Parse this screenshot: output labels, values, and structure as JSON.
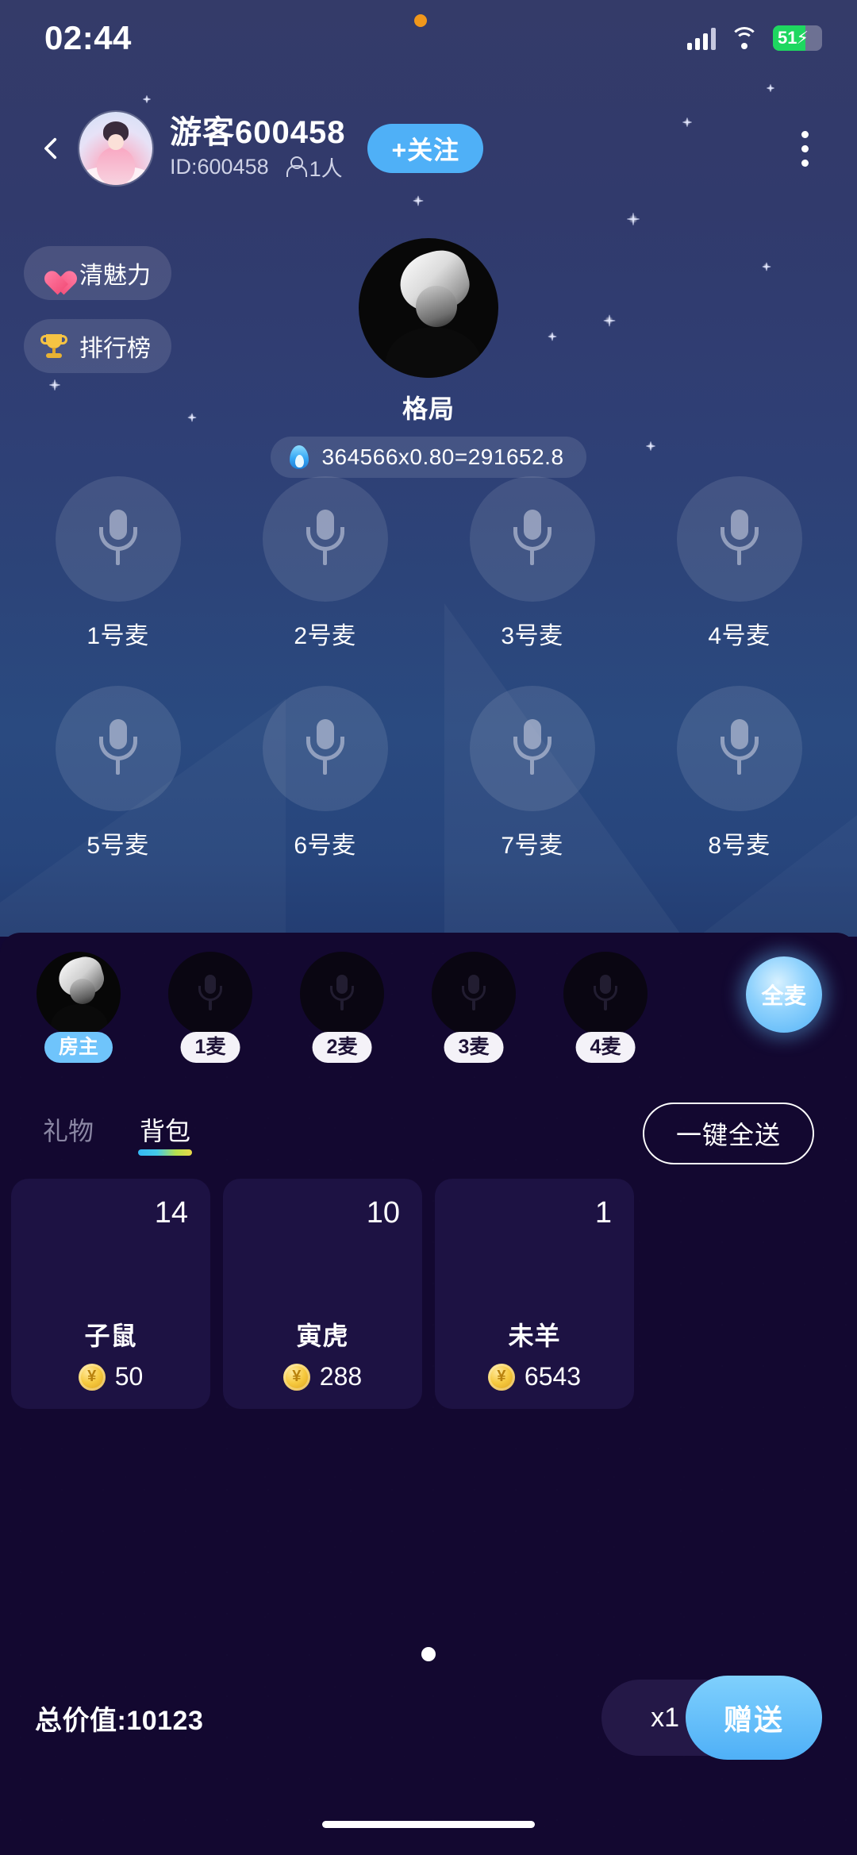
{
  "status_bar": {
    "time": "02:44",
    "moon_icon": "moon-icon",
    "signal_icon": "signal-icon",
    "wifi_icon": "wifi-icon",
    "battery_level": "51",
    "battery_charging_icon": "bolt-icon"
  },
  "header": {
    "back_icon": "back-chevron-icon",
    "avatar": "user-avatar",
    "name": "游客600458",
    "id": "ID:600458",
    "people_icon": "person-icon",
    "people_count": "1人",
    "follow_label": "+关注",
    "more_icon": "more-vertical-icon"
  },
  "badges": [
    {
      "icon": "heart-icon",
      "label": "清魅力"
    },
    {
      "icon": "trophy-icon",
      "label": "排行榜"
    }
  ],
  "host": {
    "avatar": "host-avatar",
    "name": "格局",
    "flame_icon": "flame-icon",
    "value_text": "364566x0.80=291652.8"
  },
  "mic_seats": [
    {
      "label": "1号麦",
      "icon": "microphone-icon"
    },
    {
      "label": "2号麦",
      "icon": "microphone-icon"
    },
    {
      "label": "3号麦",
      "icon": "microphone-icon"
    },
    {
      "label": "4号麦",
      "icon": "microphone-icon"
    },
    {
      "label": "5号麦",
      "icon": "microphone-icon"
    },
    {
      "label": "6号麦",
      "icon": "microphone-icon"
    },
    {
      "label": "7号麦",
      "icon": "microphone-icon"
    },
    {
      "label": "8号麦",
      "icon": "microphone-icon"
    }
  ],
  "gift_panel": {
    "recipients": [
      {
        "tag": "房主",
        "type": "owner",
        "avatar": "host-avatar"
      },
      {
        "tag": "1麦",
        "type": "num",
        "avatar": "empty-mic"
      },
      {
        "tag": "2麦",
        "type": "num",
        "avatar": "empty-mic"
      },
      {
        "tag": "3麦",
        "type": "num",
        "avatar": "empty-mic"
      },
      {
        "tag": "4麦",
        "type": "num",
        "avatar": "empty-mic"
      }
    ],
    "all_mic_label": "全麦",
    "tabs": [
      {
        "label": "礼物",
        "active": false
      },
      {
        "label": "背包",
        "active": true
      }
    ],
    "send_all_label": "一键全送",
    "gifts": [
      {
        "count": "14",
        "name": "子鼠",
        "price": "50",
        "coin_icon": "coin-icon"
      },
      {
        "count": "10",
        "name": "寅虎",
        "price": "288",
        "coin_icon": "coin-icon"
      },
      {
        "count": "1",
        "name": "未羊",
        "price": "6543",
        "coin_icon": "coin-icon"
      }
    ],
    "page_dots": 1,
    "total_value": "总价值:10123",
    "quantity_label": "x1",
    "send_label": "赠送"
  },
  "colors": {
    "accent_blue": "#4fb0f7",
    "panel_bg": "#130830",
    "card_bg": "#1d1243",
    "room_top": "#343b69",
    "coin_gold": "#f6c93f",
    "battery_green": "#1ed760"
  }
}
